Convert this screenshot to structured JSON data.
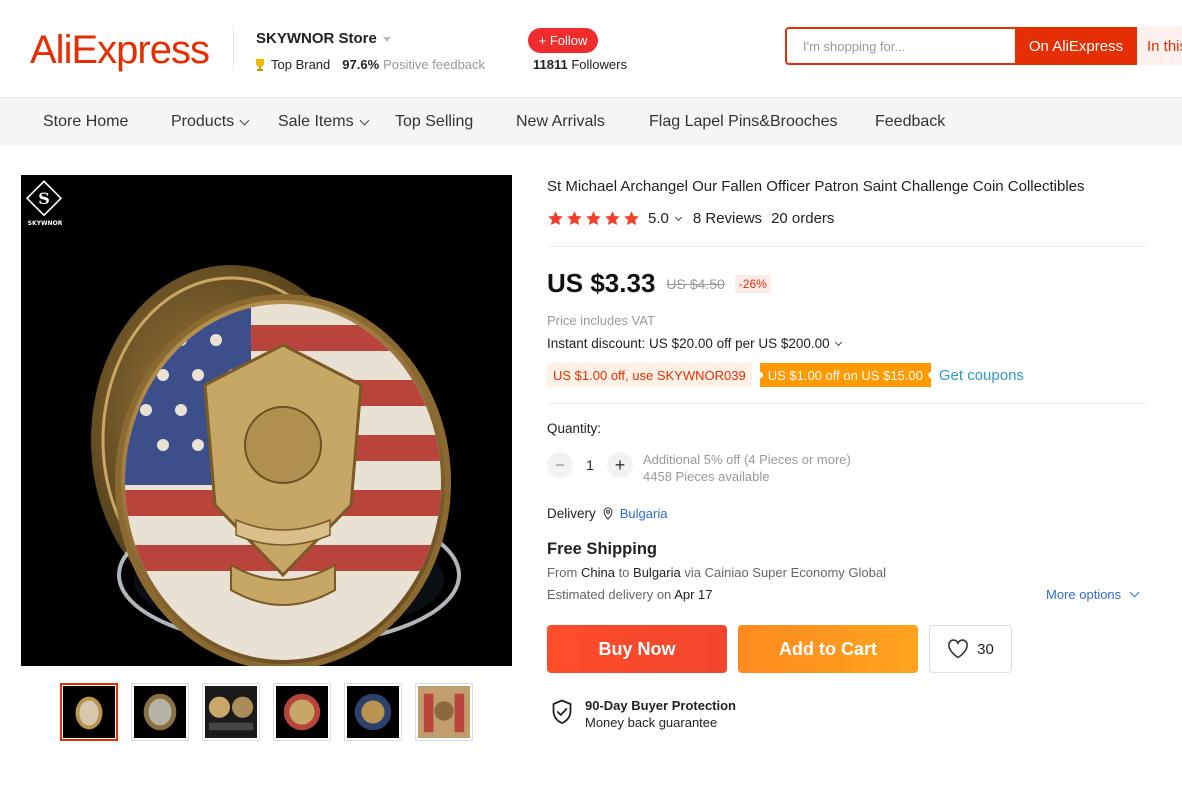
{
  "header": {
    "logo": "AliExpress",
    "store_name": "SKYWNOR Store",
    "badge": "Top Brand",
    "feedback_pct": "97.6%",
    "feedback_label": "Positive feedback",
    "follow_label": "+ Follow",
    "followers_count": "11811",
    "followers_label": "Followers",
    "search_placeholder": "I'm shopping for...",
    "search_on_ali": "On AliExpress",
    "search_in_store": "In this store"
  },
  "nav": {
    "items": [
      "Store Home",
      "Products",
      "Sale Items",
      "Top Selling",
      "New Arrivals",
      "Flag Lapel Pins&Brooches",
      "Feedback"
    ]
  },
  "product": {
    "watermark": "SKYWNOR",
    "title": "St Michael Archangel Our Fallen Officer Patron Saint Challenge Coin Collectibles",
    "rating": "5.0",
    "reviews": "8 Reviews",
    "orders": "20 orders",
    "price": "US $3.33",
    "old_price": "US $4.50",
    "discount": "-26%",
    "vat_note": "Price includes VAT",
    "instant_discount": "Instant discount: US $20.00 off per US $200.00",
    "coupon_store": "US $1.00 off, use SKYWNOR039",
    "coupon_platform": "US $1.00 off on US $15.00",
    "get_coupons": "Get coupons",
    "quantity_label": "Quantity:",
    "quantity_value": "1",
    "qty_minus": "−",
    "qty_plus": "+",
    "bulk_note": "Additional 5% off (4 Pieces or more)",
    "stock_note": "4458 Pieces available",
    "delivery_label": "Delivery",
    "delivery_country": "Bulgaria",
    "free_shipping": "Free Shipping",
    "ship_from_prefix": "From",
    "ship_from": "China",
    "ship_to_prefix": "to",
    "ship_to": "Bulgaria",
    "ship_via": "via Cainiao Super Economy Global",
    "est_prefix": "Estimated delivery on",
    "est_date": "Apr 17",
    "more_options": "More options",
    "buy_now": "Buy Now",
    "add_to_cart": "Add to Cart",
    "wishlist_count": "30",
    "protection_title": "90-Day Buyer Protection",
    "protection_sub": "Money back guarantee"
  },
  "colors": {
    "brand": "#e62e04",
    "star": "#f2402b",
    "link": "#2e6ecf",
    "coupon_orange": "#ff9a00"
  },
  "icons": [
    "trophy-icon",
    "caret-down-icon",
    "chevron-down-icon",
    "star-icon",
    "location-pin-icon",
    "heart-icon",
    "shield-check-icon"
  ]
}
